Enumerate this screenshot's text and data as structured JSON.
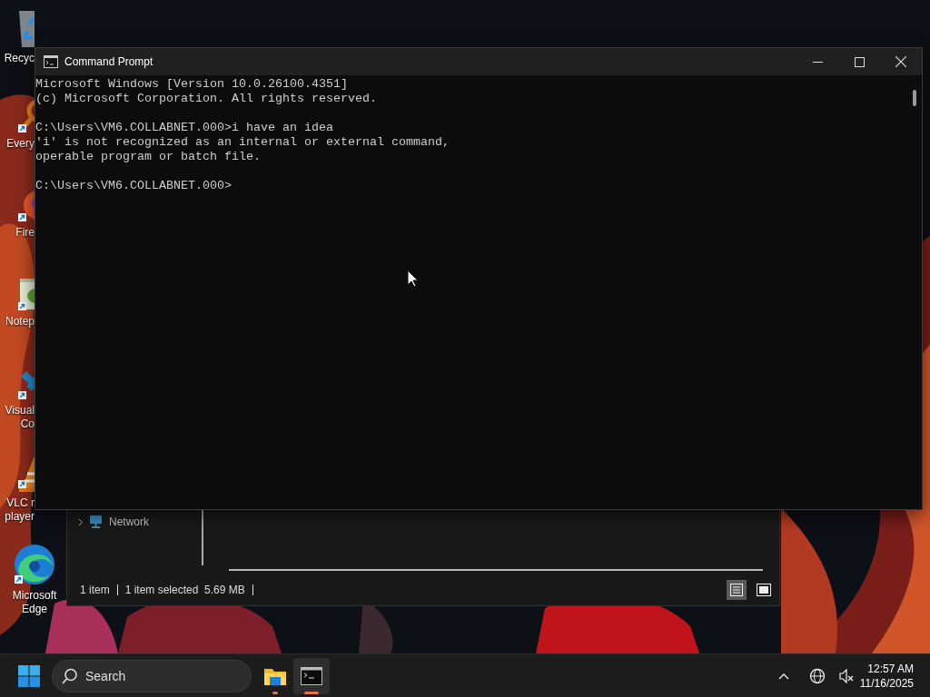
{
  "desktop_icons": [
    {
      "kind": "recycle-bin",
      "label": [
        "Recyc"
      ],
      "covered": true
    },
    {
      "kind": "search-tool",
      "label": [
        "Every"
      ],
      "covered": true
    },
    {
      "kind": "browser",
      "label": [
        "Fire"
      ],
      "covered": true
    },
    {
      "kind": "notepad",
      "label": [
        "Notep"
      ],
      "covered": true
    },
    {
      "kind": "editor",
      "label": [
        "Visual",
        "Co"
      ],
      "covered": true
    },
    {
      "kind": "media-player",
      "label": [
        "VLC r",
        "player"
      ],
      "covered": true
    },
    {
      "kind": "web-browser",
      "label": [
        "Microsoft",
        "Edge"
      ],
      "covered": false
    }
  ],
  "explorer": {
    "nav_item": {
      "label": "Network",
      "expanded": false
    },
    "status_bar": [
      "1 item",
      "1 item selected  5.69 MB"
    ],
    "view_buttons": [
      {
        "kind": "details",
        "selected": true
      },
      {
        "kind": "preview",
        "selected": false
      }
    ]
  },
  "window": {
    "title": "Command Prompt",
    "blocks": [
      [
        "Microsoft Windows [Version 10.0.26100.4351]",
        "(c) Microsoft Corporation. All rights reserved."
      ],
      [
        "C:\\Users\\VM6.COLLABNET.000>i have an idea",
        "'i' is not recognized as an internal or external command,",
        "operable program or batch file."
      ],
      [
        "C:\\Users\\VM6.COLLABNET.000>"
      ]
    ]
  },
  "taskbar": {
    "search": {
      "placeholder": "Search"
    },
    "apps": [
      {
        "kind": "folder",
        "selected": false
      },
      {
        "kind": "terminal",
        "selected": true
      }
    ],
    "tray": {
      "time": "12:57 AM",
      "date": "11/16/2025"
    }
  }
}
